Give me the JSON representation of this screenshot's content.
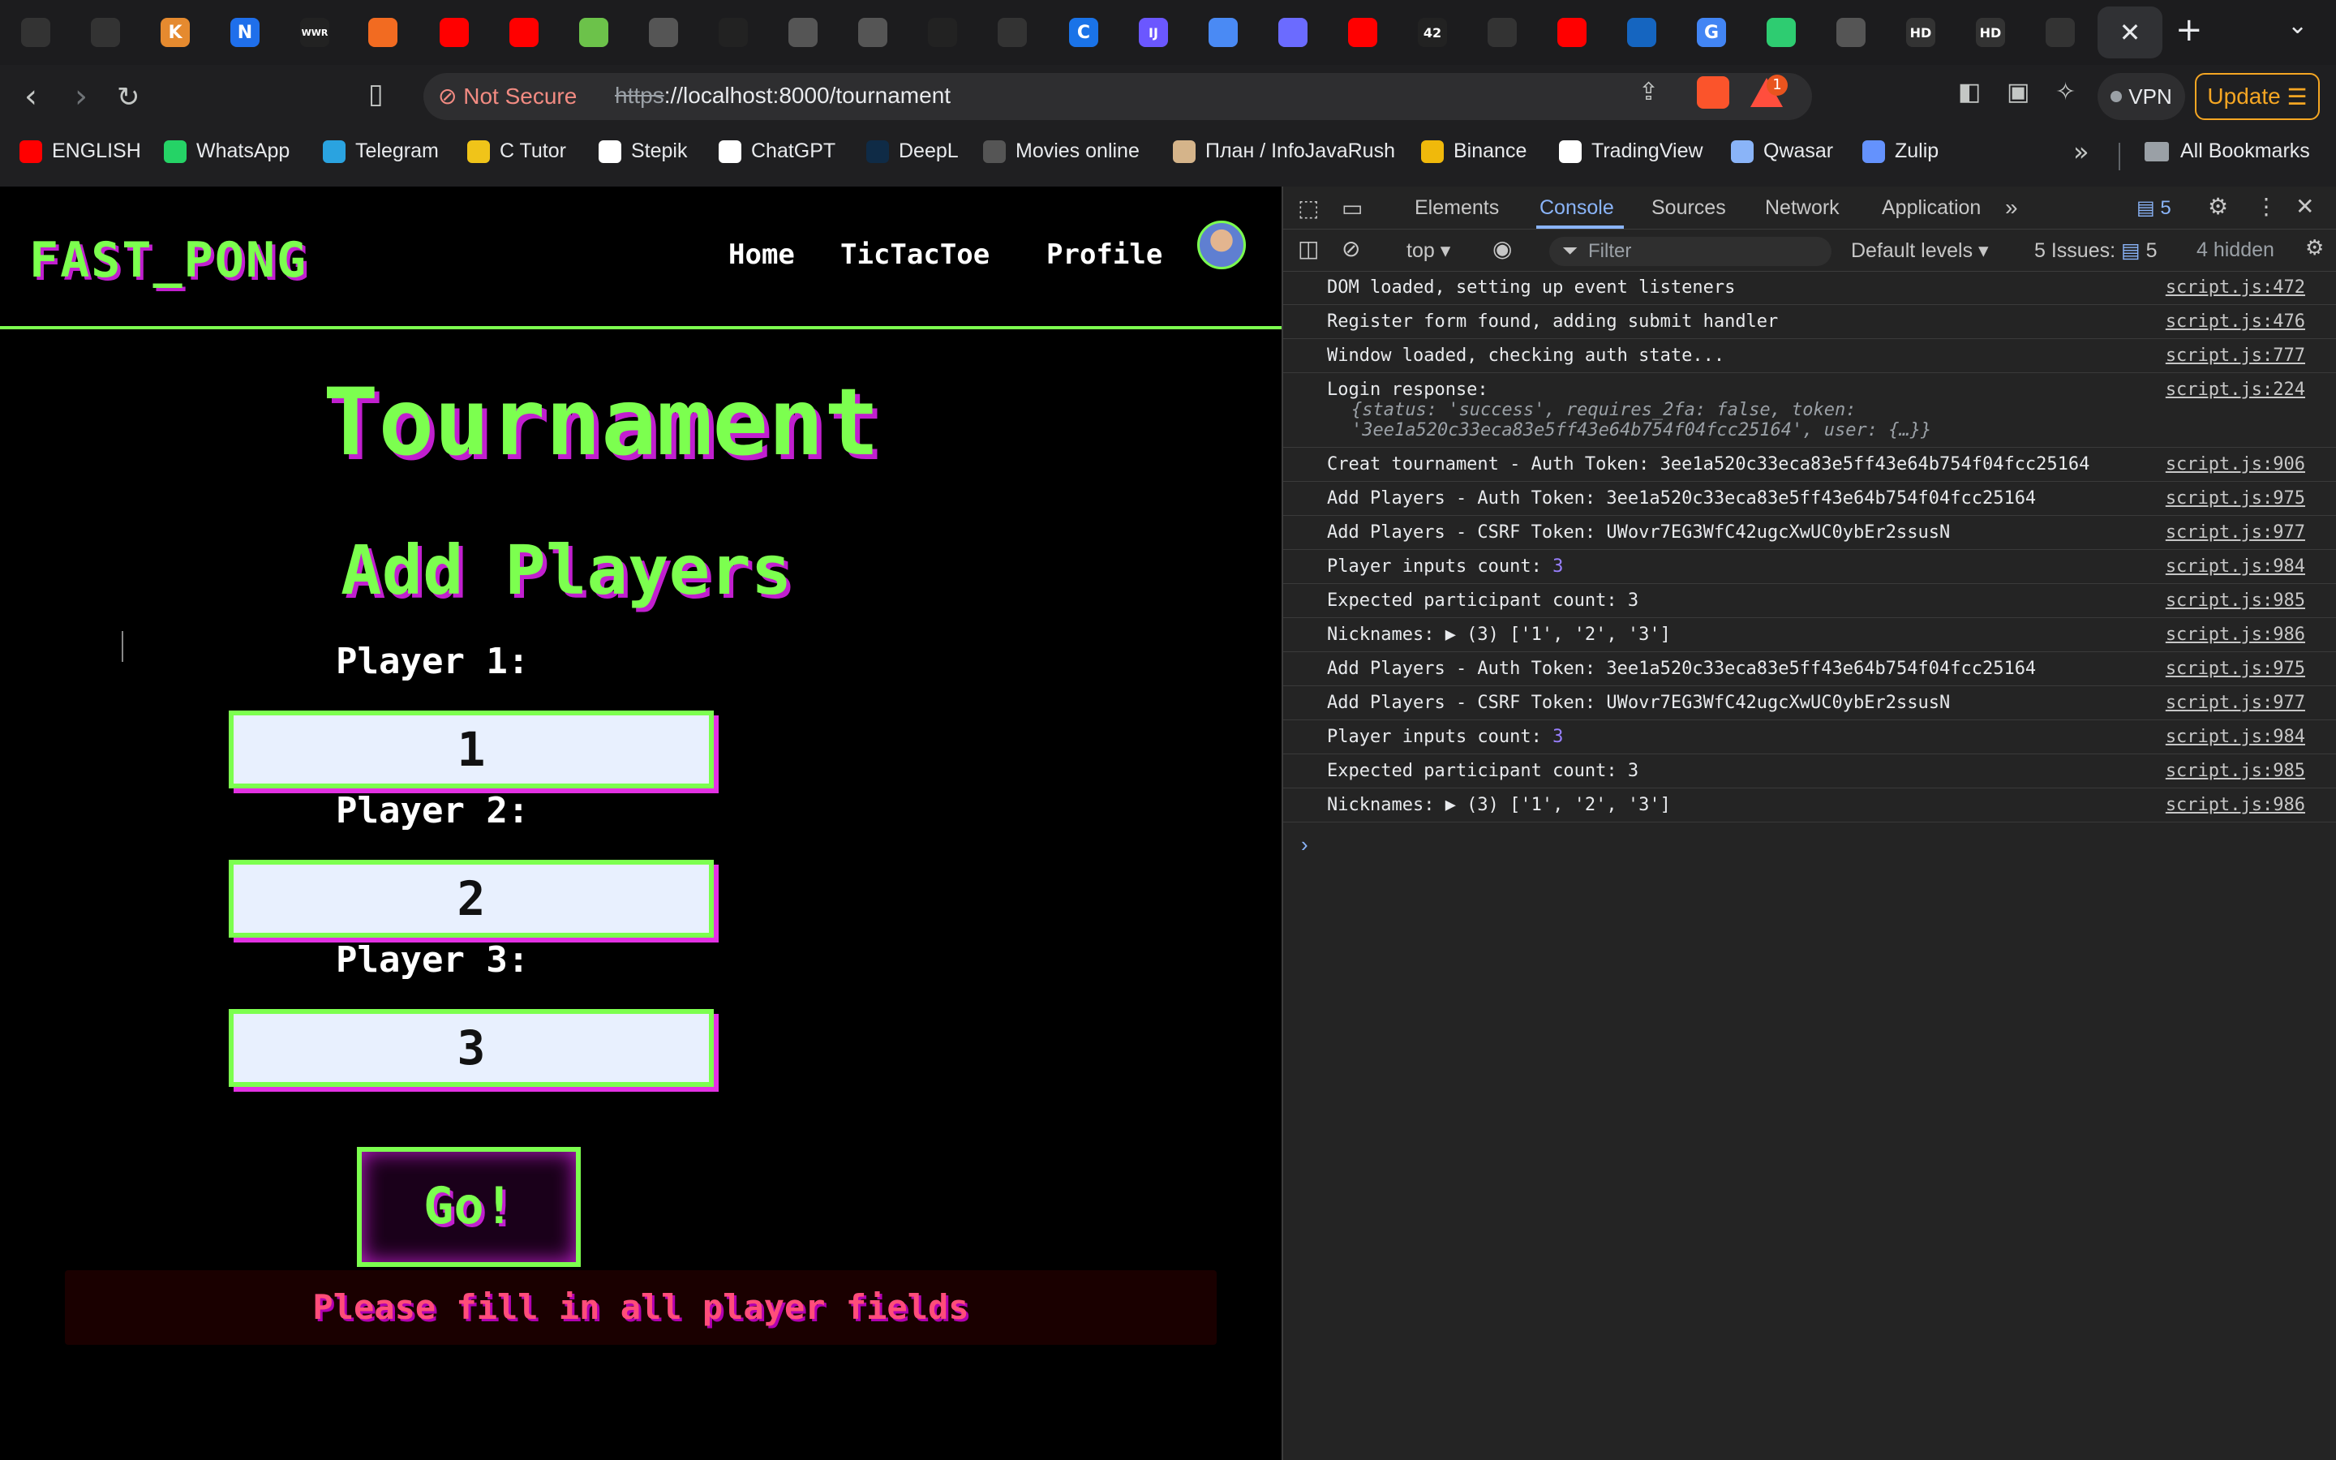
{
  "browser": {
    "tabs": [
      {
        "icon": "github-icon",
        "color": "#333"
      },
      {
        "icon": "openai-icon",
        "color": "#333"
      },
      {
        "icon": "k-icon",
        "label": "K",
        "color": "#e58a2f"
      },
      {
        "icon": "n-icon",
        "label": "N",
        "color": "#1f6feb"
      },
      {
        "icon": "wwr-icon",
        "label": "WWR",
        "color": "#222"
      },
      {
        "icon": "bars-icon",
        "color": "#f26b21"
      },
      {
        "icon": "youtube-icon",
        "color": "#ff0000"
      },
      {
        "icon": "youtube-icon",
        "color": "#ff0000"
      },
      {
        "icon": "globe-green-icon",
        "color": "#6cc24a"
      },
      {
        "icon": "printer-icon",
        "color": "#555"
      },
      {
        "icon": "star-burst-icon",
        "color": "#222"
      },
      {
        "icon": "globe-icon",
        "color": "#555"
      },
      {
        "icon": "book-icon",
        "color": "#555"
      },
      {
        "icon": "triangle-icon",
        "color": "#222"
      },
      {
        "icon": "github-icon",
        "color": "#333"
      },
      {
        "icon": "c-icon",
        "label": "C",
        "color": "#1a73e8"
      },
      {
        "icon": "intellij-icon",
        "label": "IJ",
        "color": "#6b57ff"
      },
      {
        "icon": "code-icon",
        "color": "#4a8af4"
      },
      {
        "icon": "burst-icon",
        "color": "#6b6bff"
      },
      {
        "icon": "youtube-icon",
        "color": "#ff0000"
      },
      {
        "icon": "42-icon",
        "label": "42",
        "color": "#222"
      },
      {
        "icon": "github-icon",
        "color": "#333"
      },
      {
        "icon": "youtube-icon",
        "color": "#ff0000"
      },
      {
        "icon": "edge-icon",
        "color": "#1565c0"
      },
      {
        "icon": "google-icon",
        "label": "G",
        "color": "#4285f4"
      },
      {
        "icon": "app-icon",
        "color": "#2ecc71"
      },
      {
        "icon": "globe-icon",
        "color": "#555"
      },
      {
        "icon": "hd-icon",
        "label": "HD",
        "color": "#333"
      },
      {
        "icon": "hd-icon",
        "label": "HD",
        "color": "#333"
      },
      {
        "icon": "openai-icon",
        "color": "#333"
      }
    ],
    "not_secure_label": "Not Secure",
    "url_scheme": "https",
    "url_rest": "://localhost:8000/tournament",
    "vpn_label": "VPN",
    "update_label": "Update",
    "rewards_badge": "1",
    "bookmarks": [
      {
        "label": "ENGLISH",
        "color": "#ff0000"
      },
      {
        "label": "WhatsApp",
        "color": "#25d366"
      },
      {
        "label": "Telegram",
        "color": "#2aa3e0"
      },
      {
        "label": "C Tutor",
        "color": "#f0c419"
      },
      {
        "label": "Stepik",
        "color": "#ffffff"
      },
      {
        "label": "ChatGPT",
        "color": "#ffffff"
      },
      {
        "label": "DeepL",
        "color": "#0f2b46"
      },
      {
        "label": "Movies online",
        "color": "#555"
      },
      {
        "label": "План / InfoJavaRush",
        "color": "#d5b48a"
      },
      {
        "label": "Binance",
        "color": "#f0b90b"
      },
      {
        "label": "TradingView",
        "color": "#ffffff"
      },
      {
        "label": "Qwasar",
        "color": "#8ab4f8"
      },
      {
        "label": "Zulip",
        "color": "#6492fd"
      }
    ],
    "all_bookmarks_label": "All Bookmarks"
  },
  "site": {
    "logo": "FAST_PONG",
    "nav": [
      "Home",
      "TicTacToe",
      "Profile"
    ],
    "title": "Tournament",
    "section_title": "Add Players",
    "players": [
      {
        "label": "Player 1:",
        "value": "1"
      },
      {
        "label": "Player 2:",
        "value": "2"
      },
      {
        "label": "Player 3:",
        "value": "3"
      }
    ],
    "go_label": "Go!",
    "error": "Please fill in all player fields",
    "colors": {
      "accent": "#7cff4f",
      "shadow": "#c11fcf",
      "error": "#ff4d7a"
    }
  },
  "devtools": {
    "tabs": [
      "Elements",
      "Console",
      "Sources",
      "Network",
      "Application"
    ],
    "active_tab": "Console",
    "issues_count": "5",
    "context": "top",
    "filter_placeholder": "Filter",
    "levels": "Default levels",
    "issues_label": "5 Issues:",
    "issues_num": "5",
    "hidden_label": "4 hidden",
    "logs": [
      {
        "text": "DOM loaded, setting up event listeners",
        "src": "script.js:472"
      },
      {
        "text": "Register form found, adding submit handler",
        "src": "script.js:476"
      },
      {
        "text": "Window loaded, checking auth state...",
        "src": "script.js:777"
      },
      {
        "text": "Login response:",
        "src": "script.js:224",
        "obj": "{status: 'success', requires_2fa: false, token: '3ee1a520c33eca83e5ff43e64b754f04fcc25164', user: {…}}"
      },
      {
        "text": "Creat tournament - Auth Token: 3ee1a520c33eca83e5ff43e64b754f04fcc25164",
        "src": "script.js:906"
      },
      {
        "text": "Add Players - Auth Token: 3ee1a520c33eca83e5ff43e64b754f04fcc25164",
        "src": "script.js:975"
      },
      {
        "text": "Add Players - CSRF Token: UWovr7EG3WfC42ugcXwUC0ybEr2ssusN",
        "src": "script.js:977"
      },
      {
        "text": "Player inputs count: ",
        "num": "3",
        "src": "script.js:984"
      },
      {
        "text": "Expected participant count: 3",
        "src": "script.js:985"
      },
      {
        "text": "Nicknames: ▶ (3) ['1', '2', '3']",
        "src": "script.js:986"
      },
      {
        "text": "Add Players - Auth Token: 3ee1a520c33eca83e5ff43e64b754f04fcc25164",
        "src": "script.js:975"
      },
      {
        "text": "Add Players - CSRF Token: UWovr7EG3WfC42ugcXwUC0ybEr2ssusN",
        "src": "script.js:977"
      },
      {
        "text": "Player inputs count: ",
        "num": "3",
        "src": "script.js:984"
      },
      {
        "text": "Expected participant count: 3",
        "src": "script.js:985"
      },
      {
        "text": "Nicknames: ▶ (3) ['1', '2', '3']",
        "src": "script.js:986"
      }
    ]
  }
}
